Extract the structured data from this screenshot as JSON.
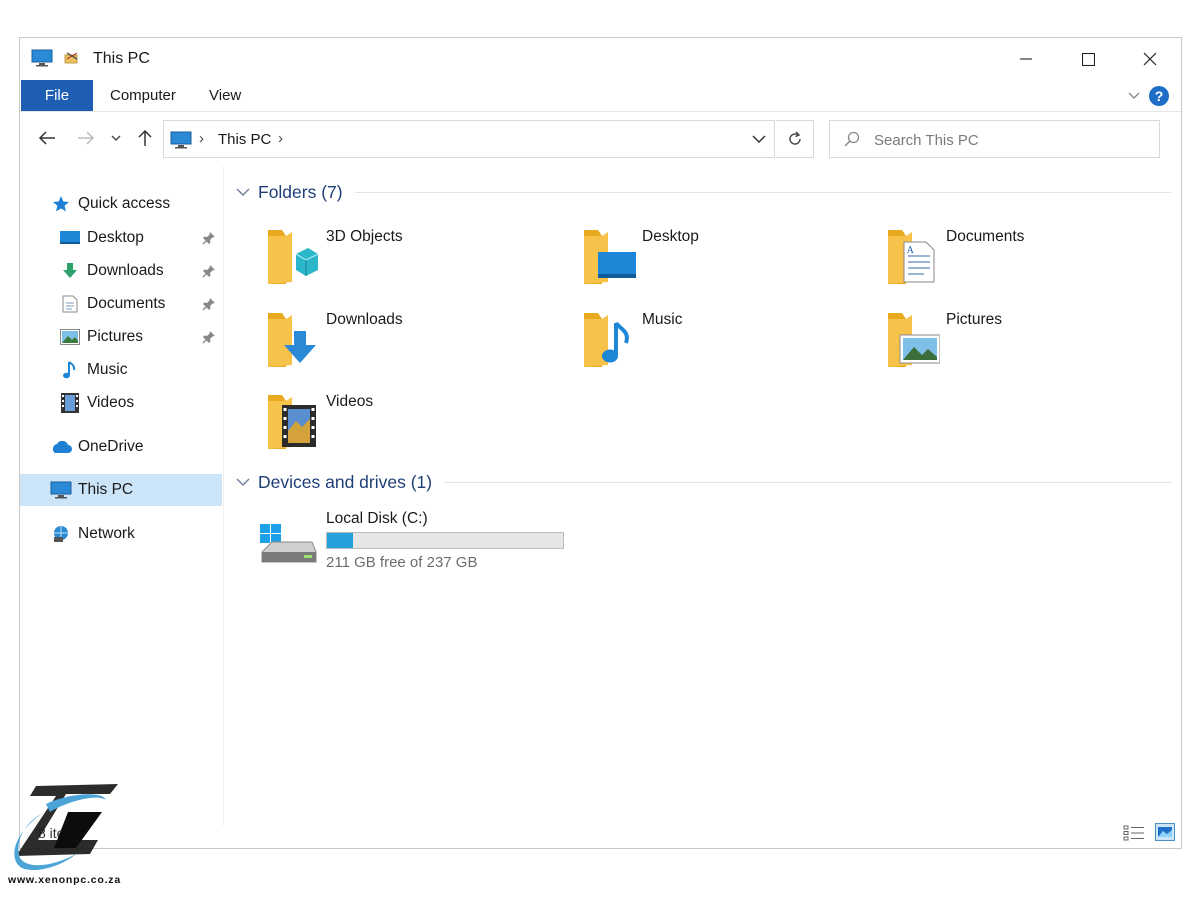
{
  "window": {
    "title": "This PC",
    "minimize_icon": "minimize-icon",
    "maximize_icon": "maximize-icon",
    "close_icon": "close-icon"
  },
  "ribbon": {
    "tabs": [
      {
        "label": "File"
      },
      {
        "label": "Computer"
      },
      {
        "label": "View"
      }
    ],
    "help_label": "?"
  },
  "navigation": {
    "breadcrumb": [
      "This PC"
    ],
    "search_placeholder": "Search This PC"
  },
  "sidebar": {
    "items": [
      {
        "label": "Quick access",
        "icon": "star-icon"
      },
      {
        "label": "Desktop",
        "icon": "desktop-icon",
        "pinned": true
      },
      {
        "label": "Downloads",
        "icon": "downloads-icon",
        "pinned": true
      },
      {
        "label": "Documents",
        "icon": "documents-icon",
        "pinned": true
      },
      {
        "label": "Pictures",
        "icon": "pictures-icon",
        "pinned": true
      },
      {
        "label": "Music",
        "icon": "music-icon"
      },
      {
        "label": "Videos",
        "icon": "videos-icon"
      },
      {
        "label": "OneDrive",
        "icon": "onedrive-icon"
      },
      {
        "label": "This PC",
        "icon": "pc-icon",
        "selected": true
      },
      {
        "label": "Network",
        "icon": "network-icon"
      }
    ]
  },
  "main": {
    "folders_header": "Folders (7)",
    "folders": [
      {
        "name": "3D Objects",
        "icon": "3d-objects-folder-icon"
      },
      {
        "name": "Desktop",
        "icon": "desktop-folder-icon"
      },
      {
        "name": "Documents",
        "icon": "documents-folder-icon"
      },
      {
        "name": "Downloads",
        "icon": "downloads-folder-icon"
      },
      {
        "name": "Music",
        "icon": "music-folder-icon"
      },
      {
        "name": "Pictures",
        "icon": "pictures-folder-icon"
      },
      {
        "name": "Videos",
        "icon": "videos-folder-icon"
      }
    ],
    "drives_header": "Devices and drives (1)",
    "drives": [
      {
        "name": "Local Disk (C:)",
        "free_text": "211 GB free of 237 GB",
        "used_fraction": 0.11
      }
    ]
  },
  "status": {
    "item_count": "8 items"
  },
  "watermark": {
    "site": "www.xenonpc.co.za"
  },
  "colors": {
    "accent": "#1e5fb4",
    "selection": "#cce4f7",
    "group_header": "#1f3f78",
    "drive_bar": "#26a0da",
    "folder": "#f6c24a"
  }
}
